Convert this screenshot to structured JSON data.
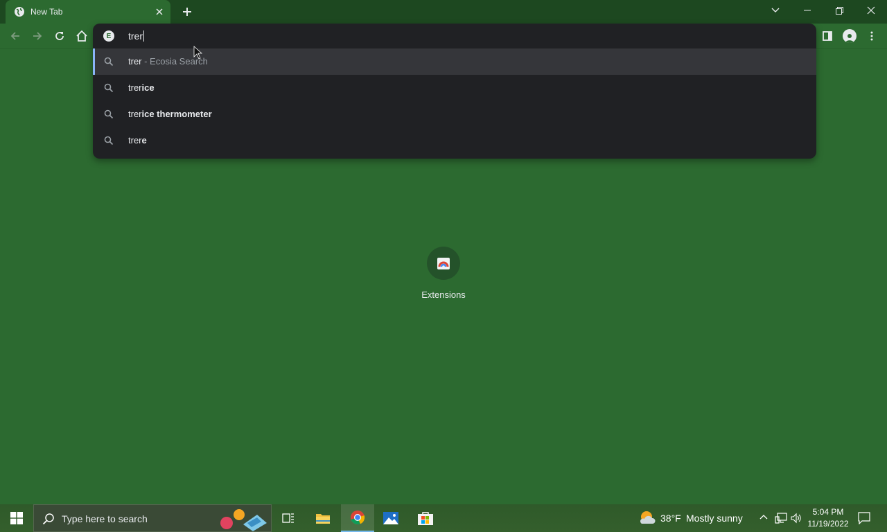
{
  "browser": {
    "tab_title": "New Tab",
    "omnibox_text": "trer",
    "suggestions": [
      {
        "typed": "trer",
        "completion": "",
        "suffix": " - Ecosia Search",
        "selected": true
      },
      {
        "typed": "trer",
        "completion": "ice",
        "suffix": "",
        "selected": false
      },
      {
        "typed": "trer",
        "completion": "ice thermometer",
        "suffix": "",
        "selected": false
      },
      {
        "typed": "trer",
        "completion": "e",
        "suffix": "",
        "selected": false
      }
    ],
    "shortcut_label": "Extensions",
    "search_engine_letter": "E"
  },
  "taskbar": {
    "search_placeholder": "Type here to search",
    "weather_temp": "38°F",
    "weather_text": "Mostly sunny",
    "time": "5:04 PM",
    "date": "11/19/2022"
  },
  "colors": {
    "page_bg": "#2c6a30",
    "tabstrip_bg": "#1d4820",
    "popup_bg": "#202124",
    "selected_row": "#35363a",
    "accent": "#8ab4f8"
  }
}
